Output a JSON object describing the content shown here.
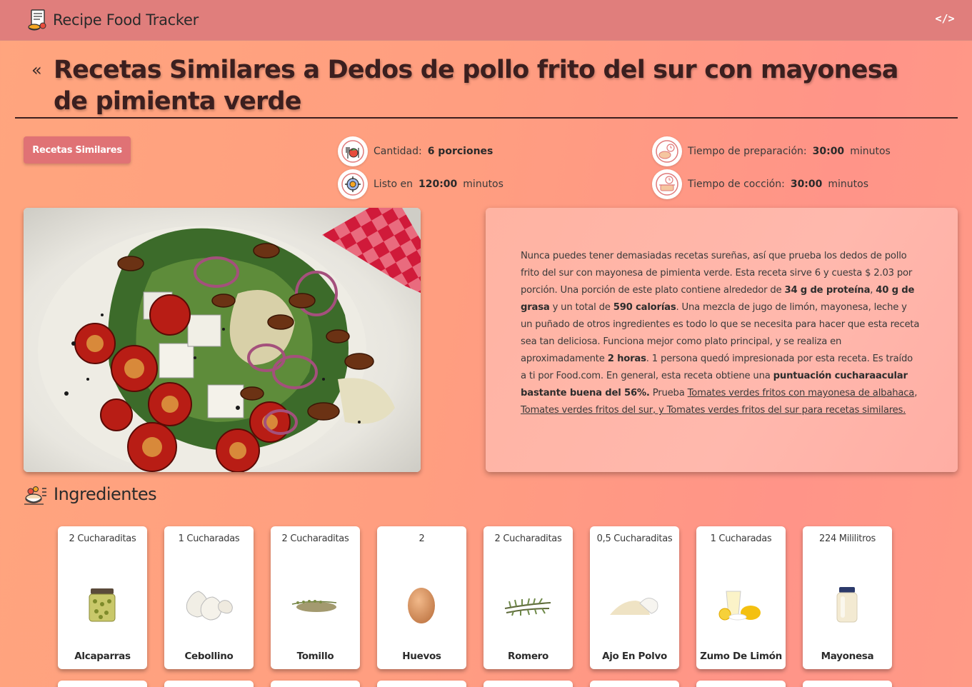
{
  "app": {
    "title": "Recipe Food Tracker"
  },
  "header": {
    "back_symbol": "«",
    "title": "Recetas Similares a Dedos de pollo frito del sur con mayonesa de pimienta verde"
  },
  "similar_button": {
    "label": "Recetas Similares"
  },
  "stats": {
    "servings": {
      "label": "Cantidad:",
      "value": "6 porciones",
      "unit": ""
    },
    "ready": {
      "label": "Listo en",
      "value": "120:00",
      "unit": "minutos"
    },
    "prep": {
      "label": "Tiempo de preparación:",
      "value": "30:00",
      "unit": "minutos"
    },
    "cook": {
      "label": "Tiempo de cocción:",
      "value": "30:00",
      "unit": "minutos"
    }
  },
  "summary": {
    "p1": "Nunca puedes tener demasiadas recetas sureñas, así que prueba los dedos de pollo frito del sur con mayonesa de pimienta verde. Esta receta sirve 6 y cuesta $ 2.03 por porción. Una porción de este plato contiene alrededor de ",
    "protein": "34 g de proteína",
    "p2": ", ",
    "fat": "40 g de grasa",
    "p3": " y un total de ",
    "calories": "590 calorías",
    "p4": ". Una mezcla de jugo de limón, mayonesa, leche y un puñado de otros ingredientes es todo lo que se necesita para hacer que esta receta sea tan deliciosa. Funciona mejor como plato principal, y se realiza en aproximadamente ",
    "time": "2 horas",
    "p5": ". 1 persona quedó impresionada por esta receta. Es traído a ti por Food.com. En general, esta receta obtiene una ",
    "score": "puntuación cucharaacular bastante buena del 56%.",
    "p6": " Prueba ",
    "link1": "Tomates verdes fritos con mayonesa de albahaca",
    "p7": ", ",
    "link2": "Tomates verdes fritos del sur",
    "p8": ", y ",
    "link3": "Tomates verdes fritos del sur para recetas similares."
  },
  "ingredients": {
    "heading": "Ingredientes",
    "items": [
      {
        "amount": "2 Cucharaditas",
        "name": "Alcaparras",
        "icon": "capers-jar-icon"
      },
      {
        "amount": "1 Cucharadas",
        "name": "Cebollino",
        "icon": "garlic-icon"
      },
      {
        "amount": "2 Cucharaditas",
        "name": "Tomillo",
        "icon": "thyme-icon"
      },
      {
        "amount": "2",
        "name": "Huevos",
        "icon": "egg-icon"
      },
      {
        "amount": "2 Cucharaditas",
        "name": "Romero",
        "icon": "rosemary-icon"
      },
      {
        "amount": "0,5 Cucharaditas",
        "name": "Ajo En Polvo",
        "icon": "garlic-powder-icon"
      },
      {
        "amount": "1 Cucharadas",
        "name": "Zumo De Limón",
        "icon": "lemon-juice-icon"
      },
      {
        "amount": "224 Mililitros",
        "name": "Mayonesa",
        "icon": "mayonnaise-jar-icon"
      }
    ]
  }
}
